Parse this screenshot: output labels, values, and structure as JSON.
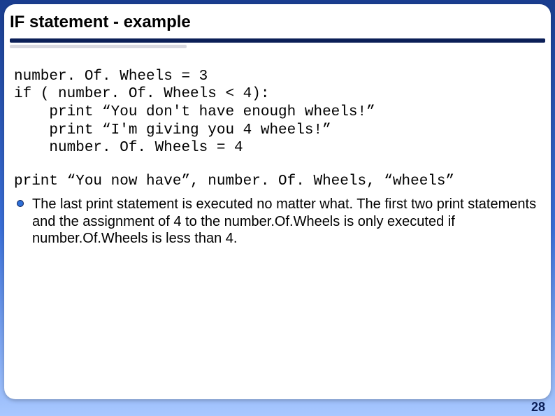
{
  "title": "IF statement - example",
  "code_line1": "number. Of. Wheels = 3",
  "code_line2": "if ( number. Of. Wheels < 4):",
  "code_line3": "    print “You don't have enough wheels!”",
  "code_line4": "    print “I'm giving you 4 wheels!”",
  "code_line5": "    number. Of. Wheels = 4",
  "code_line6": "print “You now have”, number. Of. Wheels, “wheels”",
  "bullet_text": "The last print statement is executed no matter what. The first two print statements and the assignment of 4 to the number.Of.Wheels is only executed if number.Of.Wheels is less than 4.",
  "page_number": "28"
}
